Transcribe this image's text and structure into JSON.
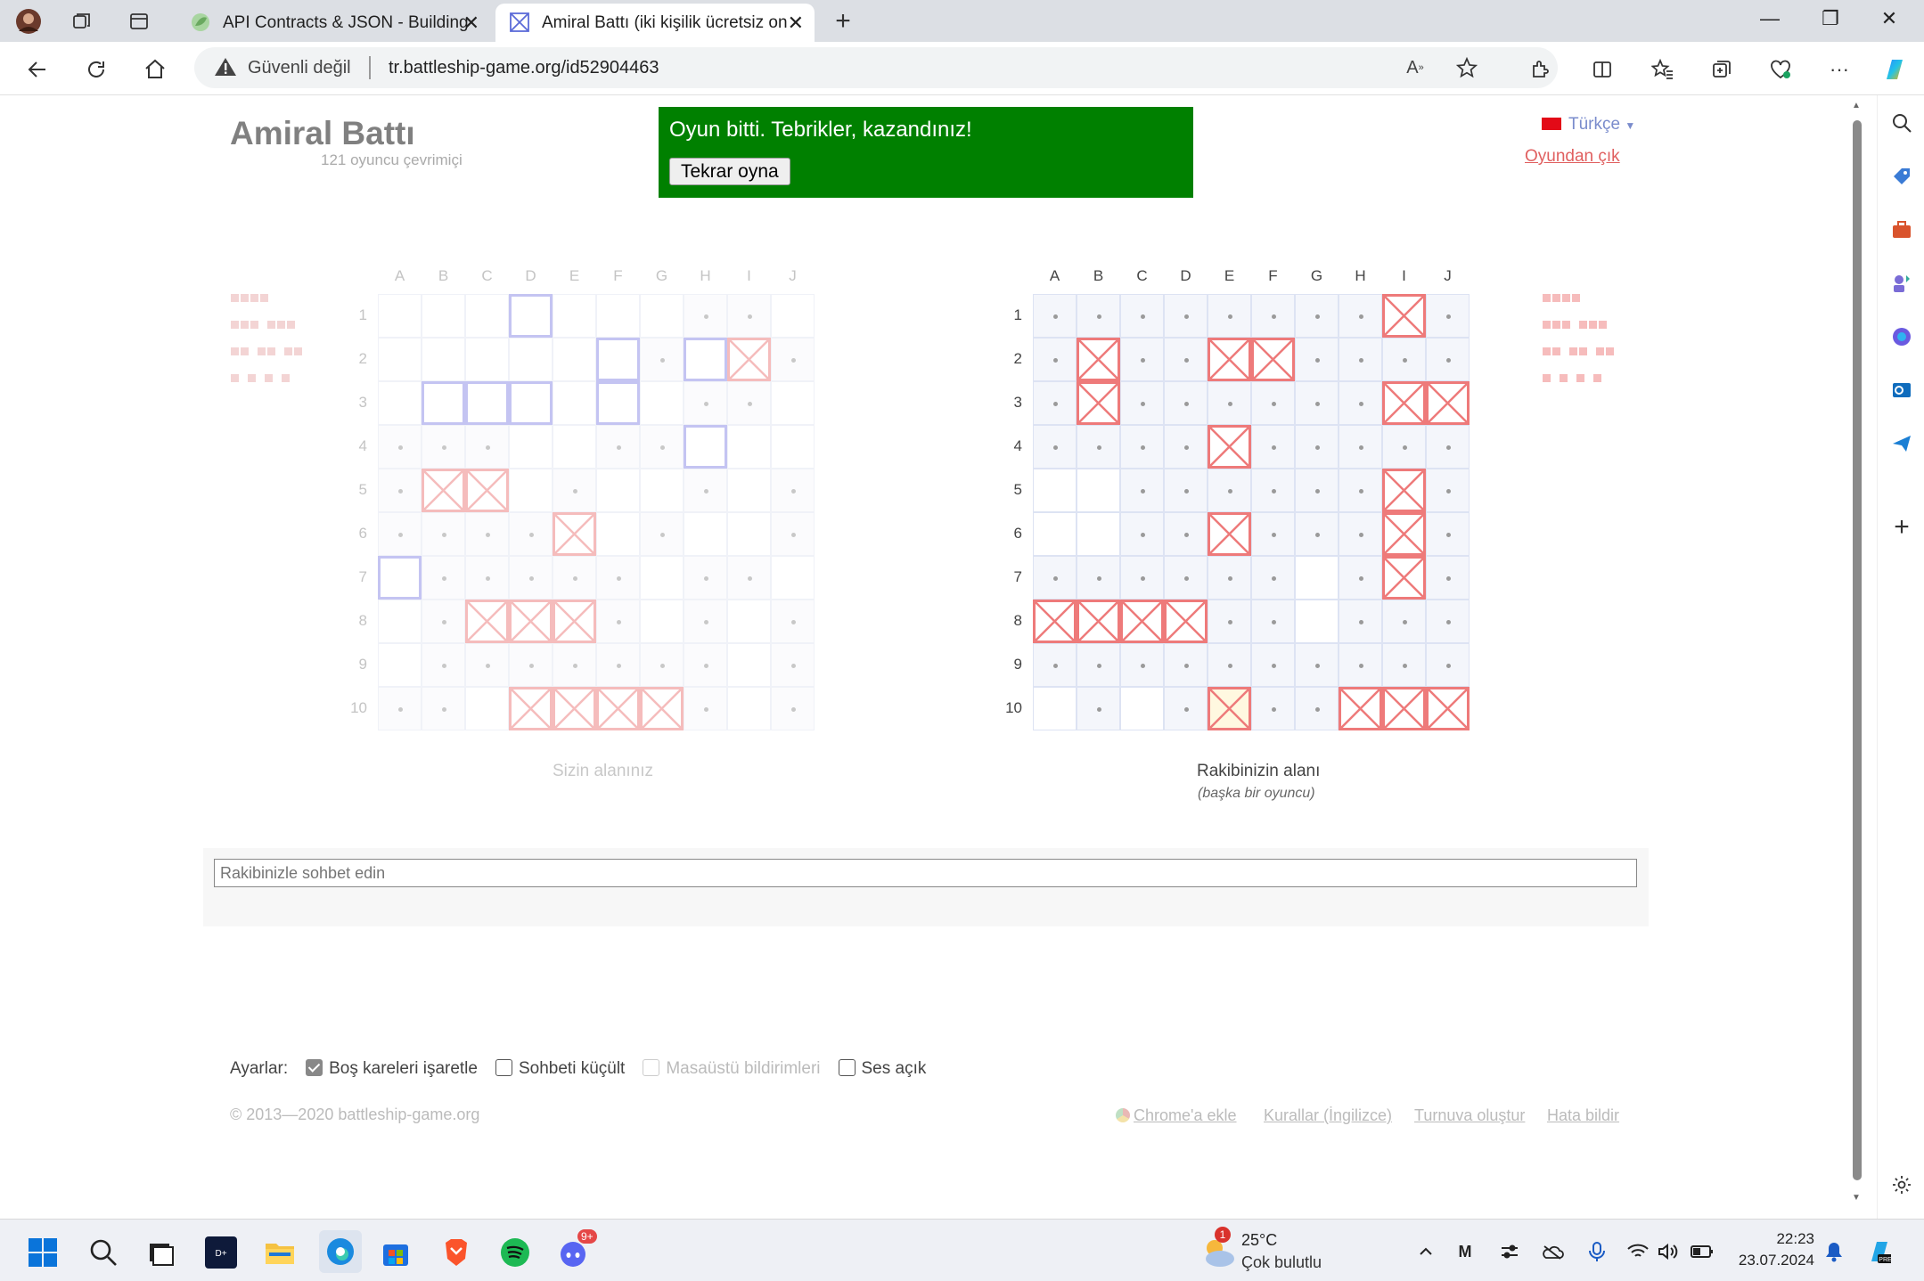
{
  "browser": {
    "tabs": [
      {
        "title": "API Contracts & JSON - Building",
        "active": false
      },
      {
        "title": "Amiral Battı (iki kişilik ücretsiz on",
        "active": true
      }
    ],
    "address": {
      "security_label": "Güvenli değil",
      "url": "tr.battleship-game.org/id52904463"
    }
  },
  "page": {
    "logo": "Amiral Battı",
    "online_count": "121 oyuncu çevrimiçi",
    "banner": {
      "message": "Oyun bitti. Tebrikler, kazandınız!",
      "button": "Tekrar oyna",
      "color": "#008000"
    },
    "language": "Türkçe",
    "leave_game": "Oyundan çık",
    "columns": [
      "A",
      "B",
      "C",
      "D",
      "E",
      "F",
      "G",
      "H",
      "I",
      "J"
    ],
    "rows": [
      "1",
      "2",
      "3",
      "4",
      "5",
      "6",
      "7",
      "8",
      "9",
      "10"
    ],
    "my_board": {
      "caption": "Sizin alanınız",
      "ships": [
        "D1",
        "F2",
        "F3",
        "H2",
        "I2",
        "B3",
        "C3",
        "D3",
        "H4",
        "A7"
      ],
      "hits": [
        "I2",
        "B5",
        "C5",
        "E6",
        "C8",
        "D8",
        "E8",
        "D10",
        "E10",
        "F10",
        "G10"
      ],
      "misses": [
        "H1",
        "I1",
        "G2",
        "J2",
        "H3",
        "I3",
        "A4",
        "B4",
        "C4",
        "F4",
        "G4",
        "A5",
        "E5",
        "H5",
        "J5",
        "A6",
        "B6",
        "C6",
        "D6",
        "G6",
        "J6",
        "B7",
        "C7",
        "D7",
        "E7",
        "F7",
        "H7",
        "I7",
        "B8",
        "F8",
        "H8",
        "J8",
        "B9",
        "C9",
        "D9",
        "E9",
        "F9",
        "G9",
        "H9",
        "J9",
        "A10",
        "B10",
        "H10",
        "J10"
      ]
    },
    "opponent_board": {
      "caption": "Rakibinizin alanı",
      "subcaption": "(başka bir oyuncu)",
      "hits": [
        "I1",
        "B2",
        "E2",
        "F2",
        "B3",
        "I3",
        "J3",
        "E4",
        "I5",
        "E6",
        "I6",
        "I7",
        "A8",
        "B8",
        "C8",
        "D8",
        "E10",
        "H10",
        "I10",
        "J10"
      ],
      "misses": [
        "A1",
        "B1",
        "C1",
        "D1",
        "E1",
        "F1",
        "G1",
        "H1",
        "J1",
        "A2",
        "C2",
        "D2",
        "G2",
        "H2",
        "I2",
        "J2",
        "A3",
        "C3",
        "D3",
        "E3",
        "F3",
        "G3",
        "H3",
        "A4",
        "B4",
        "C4",
        "D4",
        "F4",
        "G4",
        "H4",
        "I4",
        "J4",
        "C5",
        "D5",
        "E5",
        "F5",
        "G5",
        "H5",
        "J5",
        "C6",
        "D6",
        "F6",
        "G6",
        "H6",
        "J6",
        "A7",
        "B7",
        "C7",
        "D7",
        "E7",
        "F7",
        "H7",
        "J7",
        "E8",
        "F8",
        "H8",
        "I8",
        "J8",
        "A9",
        "B9",
        "C9",
        "D9",
        "E9",
        "F9",
        "G9",
        "H9",
        "I9",
        "J9",
        "B10",
        "D10",
        "F10",
        "G10"
      ]
    },
    "chat_placeholder": "Rakibinizle sohbet edin",
    "settings": {
      "label": "Ayarlar:",
      "options": [
        {
          "label": "Boş kareleri işaretle",
          "checked": true,
          "disabled": false
        },
        {
          "label": "Sohbeti küçült",
          "checked": false,
          "disabled": false
        },
        {
          "label": "Masaüstü bildirimleri",
          "checked": false,
          "disabled": true
        },
        {
          "label": "Ses açık",
          "checked": false,
          "disabled": false
        }
      ]
    },
    "copyright": "© 2013—2020 battleship-game.org",
    "footer_links": [
      "Chrome'a ekle",
      "Kurallar (İngilizce)",
      "Turnuva oluştur",
      "Hata bildir"
    ]
  },
  "taskbar": {
    "weather": {
      "temp": "25°C",
      "desc": "Çok bulutlu",
      "badge": "1"
    },
    "discord_badge": "9+",
    "time": "22:23",
    "date": "23.07.2024"
  },
  "colors": {
    "ship": "#9b9be8",
    "hit": "#ee7a7a",
    "grid": "#dde3f3",
    "accent": "#0067c0"
  }
}
